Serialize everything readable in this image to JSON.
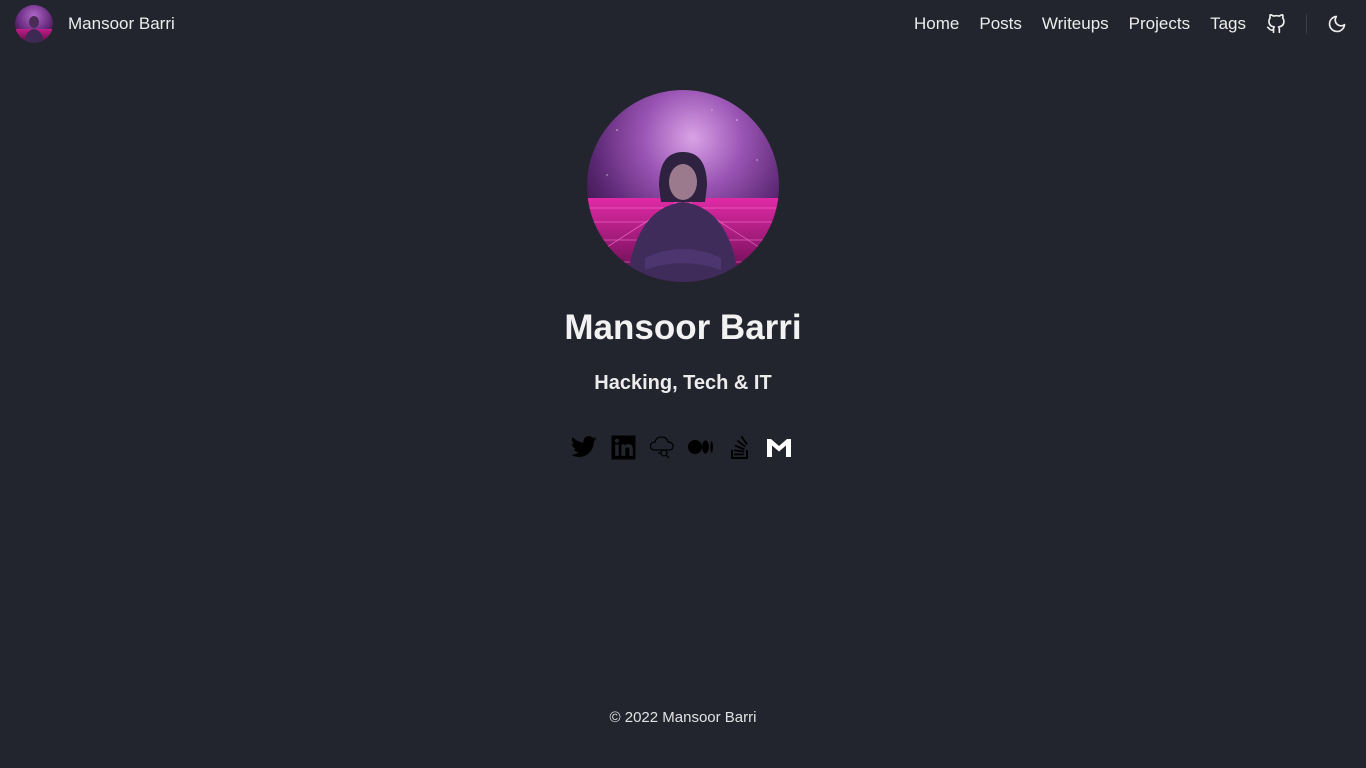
{
  "header": {
    "brand_name": "Mansoor Barri",
    "nav": [
      {
        "label": "Home"
      },
      {
        "label": "Posts"
      },
      {
        "label": "Writeups"
      },
      {
        "label": "Projects"
      },
      {
        "label": "Tags"
      }
    ],
    "icons": {
      "github": "github-icon",
      "theme_toggle": "moon-icon"
    }
  },
  "profile": {
    "name": "Mansoor Barri",
    "tagline": "Hacking, Tech & IT"
  },
  "socials": [
    {
      "icon": "twitter-icon"
    },
    {
      "icon": "linkedin-icon"
    },
    {
      "icon": "cloud-icon"
    },
    {
      "icon": "medium-icon"
    },
    {
      "icon": "stackoverflow-icon"
    },
    {
      "icon": "gmail-icon"
    }
  ],
  "footer": {
    "text": "© 2022 Mansoor Barri"
  },
  "colors": {
    "background": "#22252e",
    "text": "#ececec",
    "icon": "#000000"
  }
}
